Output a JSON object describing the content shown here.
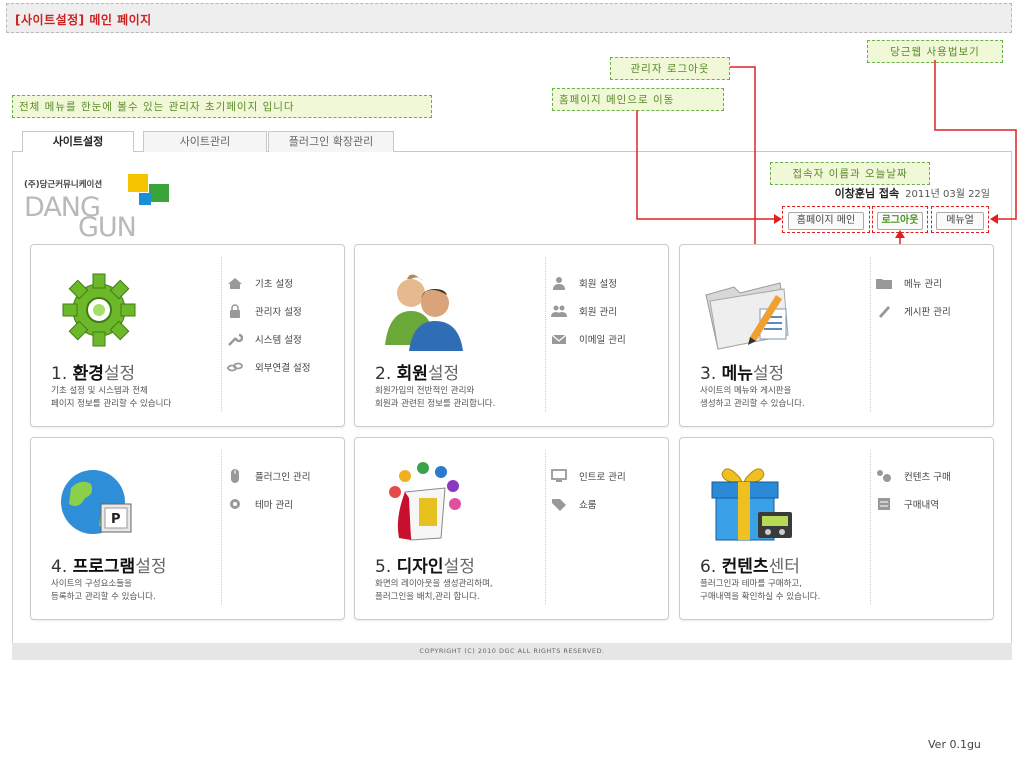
{
  "header": {
    "title": "[사이트설정] 메인 페이지"
  },
  "notes": {
    "intro": "전체 메뉴를 한눈에 볼수 있는 관리자 초기페이지 입니다",
    "home": "홈페이지 메인으로 이동",
    "logout": "관리자 로그아웃",
    "manual": "당근웹 사용법보기",
    "user": "접속자 이름과 오늘날짜"
  },
  "tabs": [
    {
      "label": "사이트설정",
      "active": true
    },
    {
      "label": "사이트관리",
      "active": false
    },
    {
      "label": "플러그인 확장관리",
      "active": false
    }
  ],
  "logo": {
    "corp": "(주)당근커뮤니케이션",
    "line1": "DANG",
    "line2": "GUN"
  },
  "user": {
    "name": "이창훈님 접속",
    "date": "2011년 03월 22일"
  },
  "buttons": {
    "home": "홈페이지 메인",
    "logout": "로그아웃",
    "manual": "메뉴얼"
  },
  "cards": [
    {
      "num": "1.",
      "bold": "환경",
      "rest": "설정",
      "desc1": "기초 설정 및 시스템과 전체",
      "desc2": "페이지 정보를 관리할 수 있습니다",
      "items": [
        {
          "icon": "home-icon",
          "label": "기초 설정"
        },
        {
          "icon": "lock-icon",
          "label": "관리자 설정"
        },
        {
          "icon": "wrench-icon",
          "label": "시스템 설정"
        },
        {
          "icon": "link-icon",
          "label": "외부연결 설정"
        }
      ]
    },
    {
      "num": "2.",
      "bold": "회원",
      "rest": "설정",
      "desc1": "회원가입의 전반적인 관리와",
      "desc2": "회원과 관련된 정보를 관리합니다.",
      "items": [
        {
          "icon": "user-icon",
          "label": "회원 설정"
        },
        {
          "icon": "users-icon",
          "label": "회원 관리"
        },
        {
          "icon": "mail-icon",
          "label": "이메일 관리"
        }
      ]
    },
    {
      "num": "3.",
      "bold": "메뉴",
      "rest": "설정",
      "desc1": "사이트의 메뉴와 게시판을",
      "desc2": "생성하고 관리할 수 있습니다.",
      "items": [
        {
          "icon": "folder-icon",
          "label": "메뉴 관리"
        },
        {
          "icon": "pencil-icon",
          "label": "게시판 관리"
        }
      ]
    },
    {
      "num": "4.",
      "bold": "프로그램",
      "rest": "설정",
      "desc1": "사이트의 구성요소들을",
      "desc2": "등록하고 관리할 수 있습니다.",
      "items": [
        {
          "icon": "mouse-icon",
          "label": "플러그인 관리"
        },
        {
          "icon": "gear-icon",
          "label": "테마 관리"
        }
      ]
    },
    {
      "num": "5.",
      "bold": "디자인",
      "rest": "설정",
      "desc1": "화면의 레이아웃을 생성관리하며,",
      "desc2": "플러그인을 배치,관리 합니다.",
      "items": [
        {
          "icon": "monitor-icon",
          "label": "인트로 관리"
        },
        {
          "icon": "tag-icon",
          "label": "쇼룸"
        }
      ]
    },
    {
      "num": "6.",
      "bold": "컨텐츠",
      "rest": "센터",
      "desc1": "플러그인과 테마를 구매하고,",
      "desc2": "구매내역을 확인하실 수 있습니다.",
      "items": [
        {
          "icon": "cart-icon",
          "label": "컨텐츠 구매"
        },
        {
          "icon": "list-icon",
          "label": "구매내역"
        }
      ]
    }
  ],
  "footer": "COPYRIGHT (C) 2010 DGC ALL RIGHTS RESERVED.",
  "version": "Ver 0.1gu",
  "colors": {
    "accent_red": "#e02020",
    "note_green": "#6ab04c",
    "title_red": "#cc2222"
  }
}
